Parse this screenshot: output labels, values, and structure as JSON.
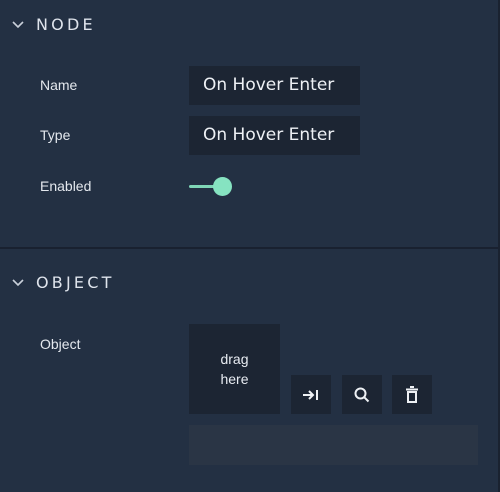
{
  "node_section": {
    "title": "NODE",
    "name_label": "Name",
    "name_value": "On Hover Enter",
    "type_label": "Type",
    "type_value": "On Hover Enter",
    "enabled_label": "Enabled",
    "enabled": true
  },
  "object_section": {
    "title": "OBJECT",
    "object_label": "Object",
    "drop_zone_text": "drag\nhere",
    "object_value": ""
  },
  "icons": {
    "collapse": "chevron-down-icon",
    "select": "arrow-to-line-icon",
    "search": "search-icon",
    "delete": "trash-icon"
  },
  "colors": {
    "panel_bg": "#233043",
    "field_bg": "#1c2533",
    "accent": "#86e3c1"
  }
}
